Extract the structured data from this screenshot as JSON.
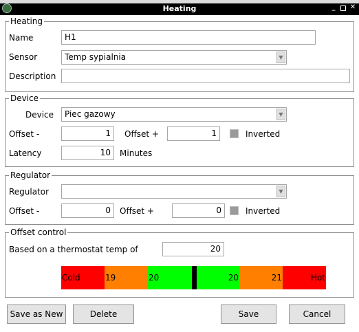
{
  "window": {
    "title": "Heating"
  },
  "heating": {
    "legend": "Heating",
    "name_label": "Name",
    "name_value": "H1",
    "sensor_label": "Sensor",
    "sensor_value": "Temp sypialnia",
    "description_label": "Description",
    "description_value": ""
  },
  "device": {
    "legend": "Device",
    "device_label": "Device",
    "device_value": "Piec gazowy",
    "offset_minus_label": "Offset -",
    "offset_minus_value": "1",
    "offset_plus_label": "Offset +",
    "offset_plus_value": "1",
    "inverted_label": "Inverted",
    "inverted_checked": false,
    "latency_label": "Latency",
    "latency_value": "10",
    "latency_unit": "Minutes"
  },
  "regulator": {
    "legend": "Regulator",
    "regulator_label": "Regulator",
    "regulator_value": "",
    "offset_minus_label": "Offset -",
    "offset_minus_value": "0",
    "offset_plus_label": "Offset +",
    "offset_plus_value": "0",
    "inverted_label": "Inverted",
    "inverted_checked": false
  },
  "offset_control": {
    "legend": "Offset control",
    "based_label": "Based on a thermostat temp of",
    "based_value": "20",
    "scale": [
      {
        "label": "Cold",
        "color": "#ff0000"
      },
      {
        "label": "19",
        "color": "#ff8000"
      },
      {
        "label": "20",
        "color": "#00ff00"
      },
      {
        "label": "20",
        "color": "#00ff00"
      },
      {
        "label": "21",
        "color": "#ff8000"
      },
      {
        "label": "Hot",
        "color": "#ff0000"
      }
    ]
  },
  "buttons": {
    "save_as_new": "Save as New",
    "delete": "Delete",
    "save": "Save",
    "cancel": "Cancel"
  },
  "icons": [
    "app-icon",
    "minimize-icon",
    "maximize-icon",
    "close-icon",
    "chevron-down-icon"
  ]
}
